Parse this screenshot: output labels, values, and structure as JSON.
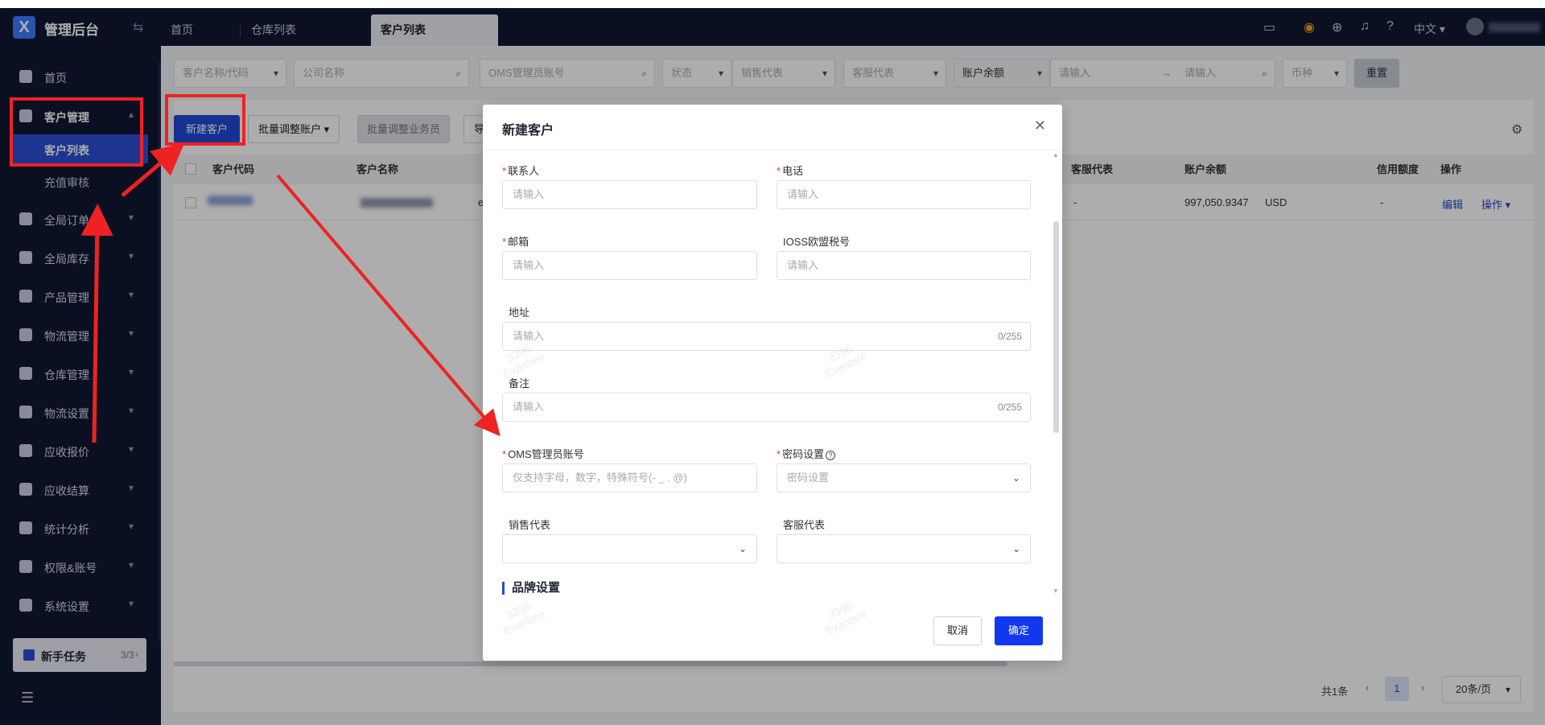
{
  "app": {
    "title": "管理后台",
    "logo": "X"
  },
  "tabs": [
    {
      "label": "首页",
      "active": false
    },
    {
      "label": "仓库列表",
      "active": false
    },
    {
      "label": "客户列表",
      "active": true
    }
  ],
  "topbar": {
    "lang": "中文",
    "icons": [
      "inbox-icon",
      "robot-icon",
      "download-icon",
      "bell-icon",
      "help-icon"
    ]
  },
  "sidebar": {
    "items": [
      {
        "label": "首页",
        "icon": "home-icon"
      },
      {
        "label": "客户管理",
        "icon": "users-icon",
        "open": true,
        "children": [
          {
            "label": "客户列表",
            "active": true
          },
          {
            "label": "充值审核"
          }
        ]
      },
      {
        "label": "全局订单",
        "icon": "order-icon"
      },
      {
        "label": "全局库存",
        "icon": "warehouse-icon"
      },
      {
        "label": "产品管理",
        "icon": "box-icon"
      },
      {
        "label": "物流管理",
        "icon": "truck-icon"
      },
      {
        "label": "仓库管理",
        "icon": "storage-icon"
      },
      {
        "label": "物流设置",
        "icon": "package-icon"
      },
      {
        "label": "应收报价",
        "icon": "quote-icon"
      },
      {
        "label": "应收结算",
        "icon": "dollar-icon"
      },
      {
        "label": "统计分析",
        "icon": "chart-icon"
      },
      {
        "label": "权限&账号",
        "icon": "org-icon"
      },
      {
        "label": "系统设置",
        "icon": "gear-icon"
      }
    ],
    "newbie": {
      "label": "新手任务",
      "count": "3/3"
    }
  },
  "filters": {
    "customer_name_code": "客户名称/代码",
    "company_name": "公司名称",
    "oms_account": "OMS管理员账号",
    "status": "状态",
    "sales_rep": "销售代表",
    "service_rep": "客服代表",
    "balance": "账户余额",
    "input_from": "请输入",
    "input_to": "请输入",
    "currency": "币种",
    "reset": "重置"
  },
  "toolbar": {
    "new_customer": "新建客户",
    "batch_adjust_account": "批量调整账户",
    "batch_adjust_sales": "批量调整业务员",
    "truncated": "导"
  },
  "table": {
    "headers": {
      "code": "客户代码",
      "name": "客户名称",
      "service_rep": "客服代表",
      "balance": "账户余额",
      "credit": "信用额度",
      "actions": "操作"
    },
    "row": {
      "service_rep": "-",
      "balance": "997,050.9347",
      "currency": "USD",
      "credit": "-",
      "edit": "编辑",
      "more": "操作",
      "partial": "e"
    }
  },
  "pagination": {
    "total": "共1条",
    "page": "1",
    "size": "20条/页"
  },
  "modal": {
    "title": "新建客户",
    "contact_label": "联系人",
    "contact_ph": "请输入",
    "phone_label": "电话",
    "phone_ph": "请输入",
    "email_label": "邮箱",
    "email_ph": "请输入",
    "ioss_label": "IOSS欧盟税号",
    "ioss_ph": "请输入",
    "address_label": "地址",
    "address_ph": "请输入",
    "address_count": "0/255",
    "remark_label": "备注",
    "remark_ph": "请输入",
    "remark_count": "0/255",
    "oms_label": "OMS管理员账号",
    "oms_ph": "仅支持字母，数字，特殊符号(- _ . @)",
    "password_label": "密码设置",
    "password_ph": "密码设置",
    "sales_label": "销售代表",
    "service_label": "客服代表",
    "brand_section": "品牌设置",
    "cancel": "取消",
    "confirm": "确定"
  },
  "watermark": {
    "line1": "3396",
    "line2": "Evanbee"
  },
  "colors": {
    "primary": "#1f4ad8",
    "sidebar": "#0f1833",
    "annotation": "#ee2222"
  }
}
